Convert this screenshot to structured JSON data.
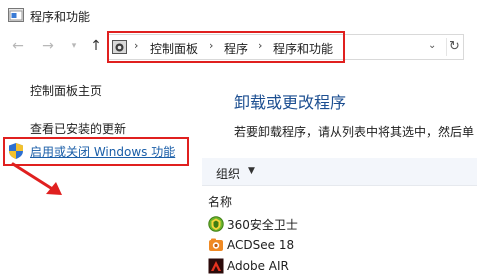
{
  "window": {
    "title": "程序和功能"
  },
  "address": {
    "crumbs": [
      "控制面板",
      "程序",
      "程序和功能"
    ]
  },
  "sidebar": {
    "home": "控制面板主页",
    "updates": "查看已安装的更新",
    "features": "启用或关闭 Windows 功能"
  },
  "main": {
    "heading": "卸载或更改程序",
    "description": "若要卸载程序，请从列表中将其选中，然后单"
  },
  "toolbar": {
    "organize": "组织"
  },
  "list": {
    "column_name": "名称",
    "items": [
      {
        "name": "360安全卫士",
        "icon": "360-safe-icon"
      },
      {
        "name": "ACDSee 18",
        "icon": "acdsee-icon"
      },
      {
        "name": "Adobe AIR",
        "icon": "adobe-air-icon"
      }
    ]
  },
  "colors": {
    "highlight": "#e0201f",
    "link": "#1a5ea8",
    "heading": "#1d4f91"
  }
}
